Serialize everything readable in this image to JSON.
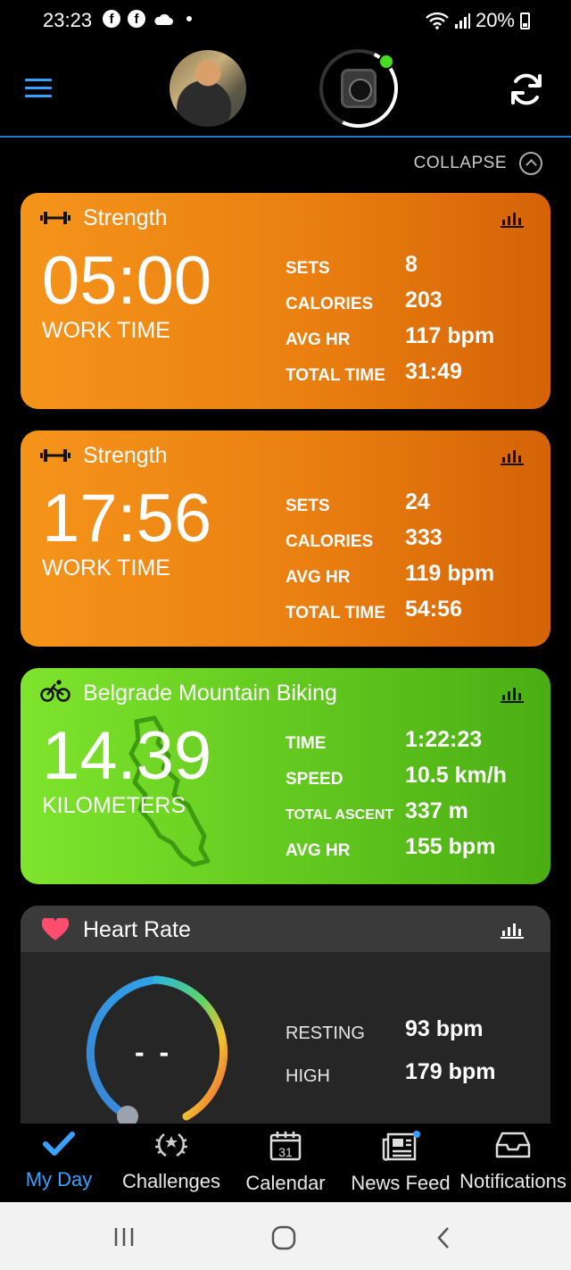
{
  "status_bar": {
    "time": "23:23",
    "battery": "20%"
  },
  "header": {
    "collapse_label": "COLLAPSE"
  },
  "cards": [
    {
      "title": "Strength",
      "big_value": "05:00",
      "big_label": "WORK TIME",
      "stats": [
        {
          "k": "SETS",
          "v": "8"
        },
        {
          "k": "CALORIES",
          "v": "203"
        },
        {
          "k": "AVG HR",
          "v": "117 bpm"
        },
        {
          "k": "TOTAL TIME",
          "v": "31:49"
        }
      ]
    },
    {
      "title": "Strength",
      "big_value": "17:56",
      "big_label": "WORK TIME",
      "stats": [
        {
          "k": "SETS",
          "v": "24"
        },
        {
          "k": "CALORIES",
          "v": "333"
        },
        {
          "k": "AVG HR",
          "v": "119 bpm"
        },
        {
          "k": "TOTAL TIME",
          "v": "54:56"
        }
      ]
    },
    {
      "title": "Belgrade Mountain Biking",
      "big_value": "14.39",
      "big_label": "KILOMETERS",
      "stats": [
        {
          "k": "TIME",
          "v": "1:22:23"
        },
        {
          "k": "SPEED",
          "v": "10.5 km/h"
        },
        {
          "k": "TOTAL ASCENT",
          "v": "337 m"
        },
        {
          "k": "AVG HR",
          "v": "155 bpm"
        }
      ]
    }
  ],
  "heart_rate": {
    "title": "Heart Rate",
    "current": "- -",
    "stats": [
      {
        "k": "RESTING",
        "v": "93 bpm"
      },
      {
        "k": "HIGH",
        "v": "179 bpm"
      }
    ]
  },
  "bottom_nav": [
    {
      "label": "My Day",
      "icon": "check-icon",
      "active": true
    },
    {
      "label": "Challenges",
      "icon": "laurel-icon"
    },
    {
      "label": "Calendar",
      "icon": "calendar-icon",
      "day": "31"
    },
    {
      "label": "News Feed",
      "icon": "newsfeed-icon"
    },
    {
      "label": "Notifications",
      "icon": "inbox-icon"
    }
  ],
  "colors": {
    "accent": "#3aa0ff",
    "strength": "#ea7f10",
    "biking": "#5fc41d",
    "new_device_dot": "#44dd22"
  }
}
